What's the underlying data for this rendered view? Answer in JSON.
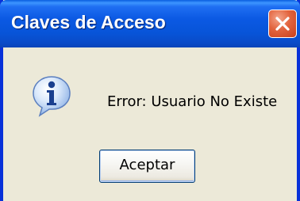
{
  "window": {
    "title": "Claves de Acceso"
  },
  "dialog": {
    "message": "Error: Usuario No Existe",
    "icon": "info-icon",
    "ok_label": "Aceptar"
  },
  "colors": {
    "titlebar_blue": "#0754d8",
    "close_red": "#e2643e",
    "dialog_bg": "#ece9d8"
  }
}
